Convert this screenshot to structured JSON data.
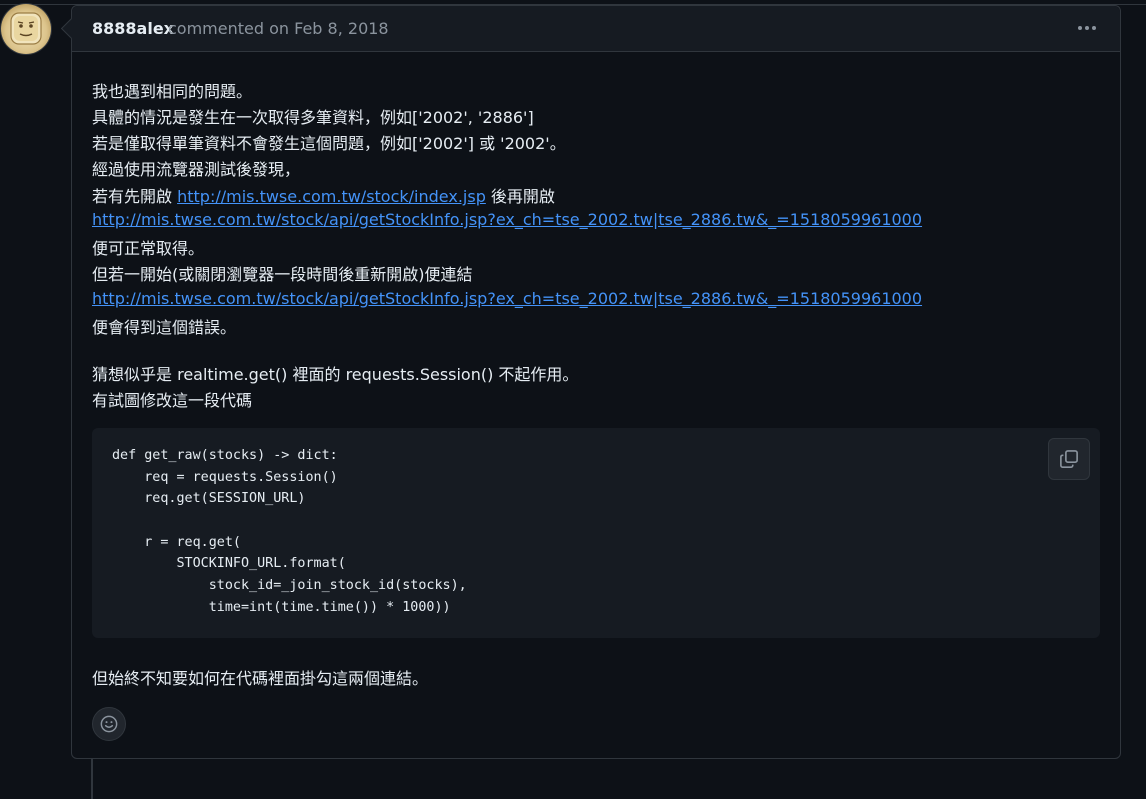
{
  "comment": {
    "author": "8888alex",
    "meta": "commented on Feb 8, 2018",
    "actions_icon": "kebab-horizontal-icon",
    "avatar_icon": "user-avatar"
  },
  "body": {
    "p1_line1": "我也遇到相同的問題。",
    "p1_line2": "具體的情況是發生在一次取得多筆資料，例如['2002', '2886']",
    "p1_line3": "若是僅取得單筆資料不會發生這個問題，例如['2002'] 或 '2002'。",
    "p1_line4": "經過使用流覽器測試後發現，",
    "p1_line5_prefix": "若有先開啟 ",
    "p1_line5_link": "http://mis.twse.com.tw/stock/index.jsp",
    "p1_line5_suffix": " 後再開啟",
    "p1_line6_link": "http://mis.twse.com.tw/stock/api/getStockInfo.jsp?ex_ch=tse_2002.tw|tse_2886.tw&_=1518059961000",
    "p1_line7": "便可正常取得。",
    "p1_line8": "但若一開始(或關閉瀏覽器一段時間後重新開啟)便連結",
    "p1_line9_link": "http://mis.twse.com.tw/stock/api/getStockInfo.jsp?ex_ch=tse_2002.tw|tse_2886.tw&_=1518059961000",
    "p1_line10": "便會得到這個錯誤。",
    "p2_line1": "猜想似乎是 realtime.get() 裡面的 requests.Session() 不起作用。",
    "p2_line2": "有試圖修改這一段代碼",
    "p3_line1": "但始終不知要如何在代碼裡面掛勾這兩個連結。"
  },
  "code": {
    "lines": [
      "def get_raw(stocks) -> dict:",
      "    req = requests.Session()",
      "    req.get(SESSION_URL)",
      "",
      "    r = req.get(",
      "        STOCKINFO_URL.format(",
      "            stock_id=_join_stock_id(stocks),",
      "            time=int(time.time()) * 1000))"
    ],
    "copy_icon": "copy-icon"
  },
  "reaction": {
    "icon": "smiley-icon"
  },
  "colors": {
    "background": "#0d1117",
    "header": "#161b22",
    "border": "#30363d",
    "link": "#4493f8",
    "muted": "#8b949e",
    "text": "#e6edf3"
  }
}
